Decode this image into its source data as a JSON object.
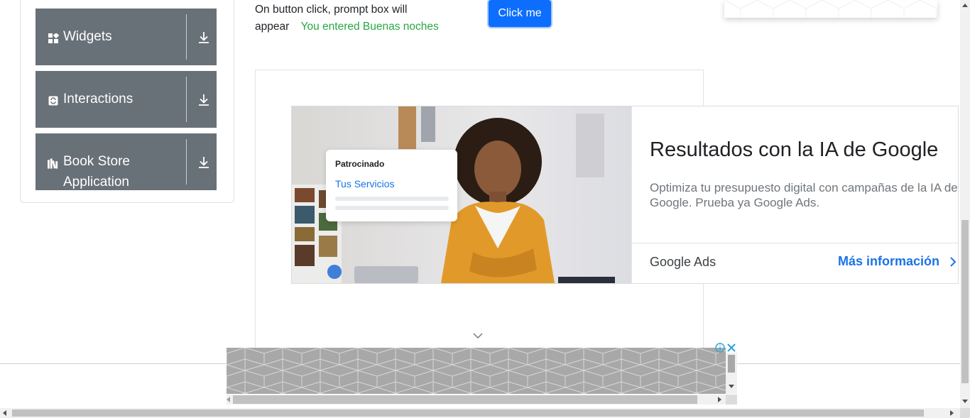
{
  "sidebar": {
    "groups": [
      {
        "label": "Widgets",
        "icon": "widgets-icon"
      },
      {
        "label": "Interactions",
        "icon": "interactions-icon"
      },
      {
        "label": "Book Store Application",
        "icon": "book-store-icon"
      }
    ]
  },
  "prompt_section": {
    "description": "On button click, prompt box will appear",
    "result": "You entered Buenas noches",
    "button_label": "Click me"
  },
  "ad": {
    "sponsored_label": "Patrocinado",
    "mock_link": "Tus Servicios",
    "title": "Resultados con la IA de Google",
    "description": "Optimiza tu presupuesto digital con campañas de la IA de Google. Prueba ya Google Ads.",
    "brand": "Google Ads",
    "cta": "Más información"
  },
  "colors": {
    "sidebar_group_bg": "#687078",
    "primary_button": "#0d6efd",
    "success_text": "#28a745",
    "ad_link": "#1a73e8"
  }
}
